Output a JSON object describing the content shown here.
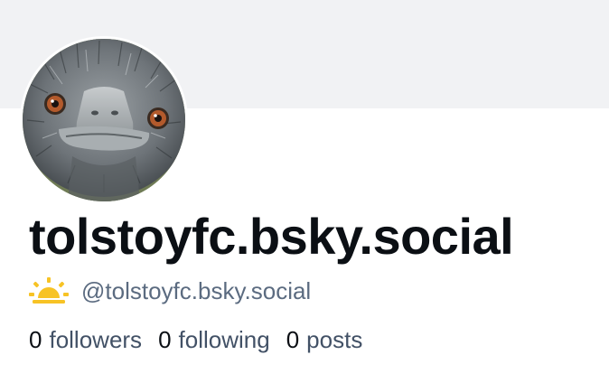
{
  "profile": {
    "display_name": "tolstoyfc.bsky.social",
    "handle": "@tolstoyfc.bsky.social",
    "handle_icon": "sunrise-icon",
    "avatar_image": "emu-face-avatar"
  },
  "stats": {
    "followers_count": "0",
    "followers_label": "followers",
    "following_count": "0",
    "following_label": "following",
    "posts_count": "0",
    "posts_label": "posts"
  },
  "colors": {
    "banner": "#f1f2f4",
    "name_text": "#0b0f14",
    "muted_text": "#5b6b80",
    "sun_yellow": "#f7c325"
  }
}
